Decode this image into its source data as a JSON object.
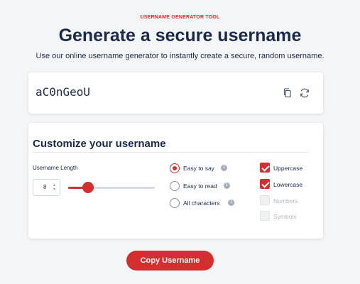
{
  "header": {
    "eyebrow": "USERNAME GENERATOR TOOL",
    "title": "Generate a secure username",
    "subtitle": "Use our online username generator to instantly create a secure, random username."
  },
  "result": {
    "username": "aC0nGeoU",
    "copy_icon": "copy-icon",
    "refresh_icon": "refresh-icon"
  },
  "customize": {
    "title": "Customize your username",
    "length_label": "Username Length",
    "length_value": "8",
    "length_fraction": 0.23,
    "radio_options": [
      {
        "label": "Easy to say",
        "selected": true
      },
      {
        "label": "Easy to read",
        "selected": false
      },
      {
        "label": "All characters",
        "selected": false
      }
    ],
    "checkbox_options": [
      {
        "label": "Uppercase",
        "checked": true,
        "enabled": true
      },
      {
        "label": "Lowercase",
        "checked": true,
        "enabled": true
      },
      {
        "label": "Numbers",
        "checked": false,
        "enabled": false
      },
      {
        "label": "Symbols",
        "checked": false,
        "enabled": false
      }
    ]
  },
  "copy_button_label": "Copy Username",
  "colors": {
    "accent": "#d32f2f",
    "text": "#1b2a4a",
    "background": "#f4f5f7"
  }
}
